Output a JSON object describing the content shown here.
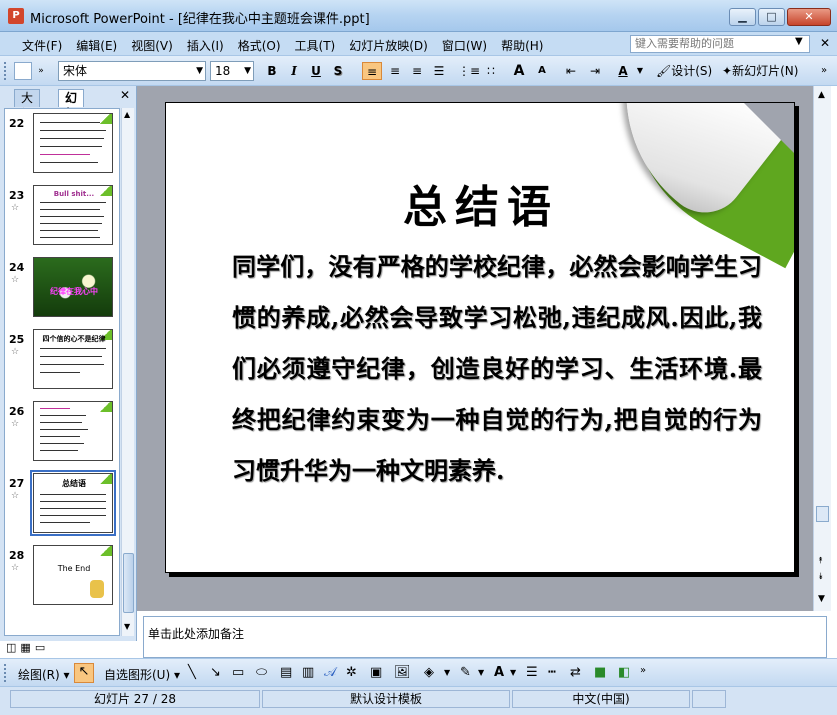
{
  "window": {
    "title": "Microsoft PowerPoint - [纪律在我心中主题班会课件.ppt]",
    "app_icon": "P",
    "minimize": "▁",
    "maximize": "□",
    "close": "✕"
  },
  "menu": {
    "items": [
      "文件(F)",
      "编辑(E)",
      "视图(V)",
      "插入(I)",
      "格式(O)",
      "工具(T)",
      "幻灯片放映(D)",
      "窗口(W)",
      "帮助(H)"
    ],
    "help_placeholder": "键入需要帮助的问题",
    "close_glyph": "✕"
  },
  "toolbar": {
    "font": "宋体",
    "size": "18",
    "bold": "B",
    "italic": "I",
    "underline": "U",
    "shadow": "S",
    "grow_font": "A",
    "shrink_font": "A",
    "font_color": "A",
    "design": "设计(S)",
    "new_slide": "新幻灯片(N)"
  },
  "left_pane": {
    "tab_outline": "大纲",
    "tab_slides": "幻灯片",
    "close": "✕",
    "thumbnails": [
      {
        "num": "22",
        "star": "",
        "kind": "text"
      },
      {
        "num": "23",
        "star": "☆",
        "kind": "text",
        "title": "Bull shit..."
      },
      {
        "num": "24",
        "star": "☆",
        "kind": "flower",
        "title": "纪律在我心中"
      },
      {
        "num": "25",
        "star": "☆",
        "kind": "text",
        "title": "四个信的心不是纪律"
      },
      {
        "num": "26",
        "star": "☆",
        "kind": "text"
      },
      {
        "num": "27",
        "star": "☆",
        "kind": "text",
        "title": "总结语",
        "selected": true
      },
      {
        "num": "28",
        "star": "☆",
        "kind": "end",
        "title": "The End"
      }
    ]
  },
  "slide": {
    "title": "总结语",
    "body": "同学们，没有严格的学校纪律，必然会影响学生习惯的养成,必然会导致学习松弛,违纪成风.因此,我们必须遵守纪律，创造良好的学习、生活环境.最终把纪律约束变为一种自觉的行为,把自觉的行为习惯升华为一种文明素养."
  },
  "notes": {
    "placeholder": "单击此处添加备注"
  },
  "drawbar": {
    "draw": "绘图(R)",
    "autoshapes": "自选图形(U)"
  },
  "status": {
    "slide_info": "幻灯片 27 / 28",
    "template": "默认设计模板",
    "language": "中文(中国)"
  }
}
